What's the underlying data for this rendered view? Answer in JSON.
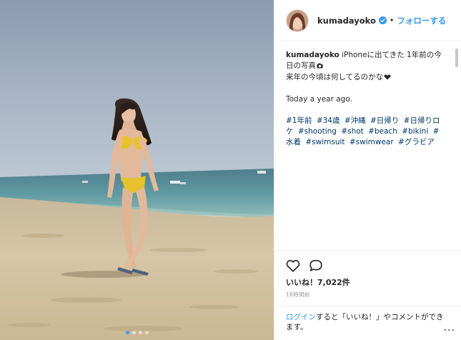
{
  "photo": {
    "carousel_total": 4,
    "carousel_active_index": 0
  },
  "header": {
    "username": "kumadayoko",
    "separator": "•",
    "follow_label": "フォローする",
    "verified_icon": "verified-badge-icon"
  },
  "caption": {
    "user": "kumadayoko",
    "line1": " iPhoneに出てきた 1年前の今日の写真",
    "camera_icon": "camera-icon",
    "line2": "来年の今頃は何してるのかな",
    "heart_icon": "heart-emoji-icon",
    "line3": "Today a year ago.",
    "hashtags": [
      "#1年前",
      "#34歳",
      "#沖縄",
      "#日帰り",
      "#日帰りロケ",
      "#shooting",
      "#shot",
      "#beach",
      "#bikini",
      "#水着",
      "#swimsuit",
      "#swimwear",
      "#グラビア"
    ]
  },
  "actions": {
    "like_icon": "heart-outline-icon",
    "comment_icon": "comment-bubble-icon"
  },
  "stats": {
    "likes": "いいね！7,022件",
    "time": "16時間前"
  },
  "login": {
    "link": "ログイン",
    "text": "すると「いいね！」やコメントができます。",
    "more": "..."
  },
  "colors": {
    "link_blue": "#3897f0",
    "hashtag_blue": "#003569",
    "text": "#262626",
    "muted": "#999999"
  }
}
